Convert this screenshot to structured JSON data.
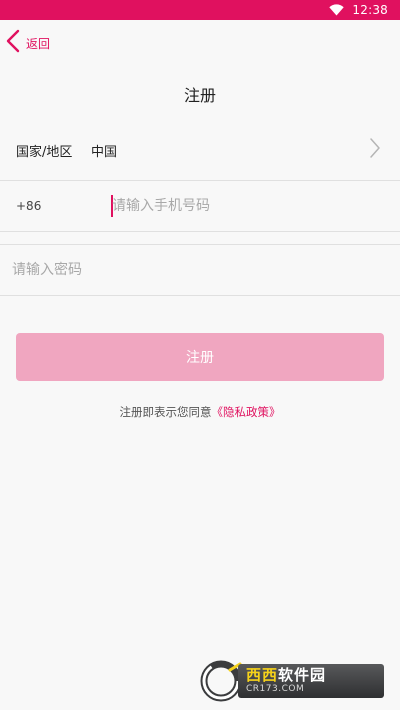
{
  "status_bar": {
    "time": "12:38",
    "wifi_icon": "wifi-icon",
    "background_color": "#e0115f"
  },
  "header": {
    "back_label": "返回",
    "title": "注册",
    "accent_color": "#e0115f"
  },
  "form": {
    "region": {
      "label": "国家/地区",
      "value": "中国"
    },
    "phone": {
      "country_code": "+86",
      "placeholder": "请输入手机号码",
      "value": ""
    },
    "password": {
      "placeholder": "请输入密码",
      "value": ""
    },
    "submit_label": "注册",
    "submit_color": "#f0a6c0"
  },
  "agreement": {
    "prefix": "注册即表示您同意",
    "link_text": "《隐私政策》"
  },
  "watermark": {
    "brand_part1": "西西",
    "brand_part2": "软件园",
    "url": "CR173.COM"
  }
}
